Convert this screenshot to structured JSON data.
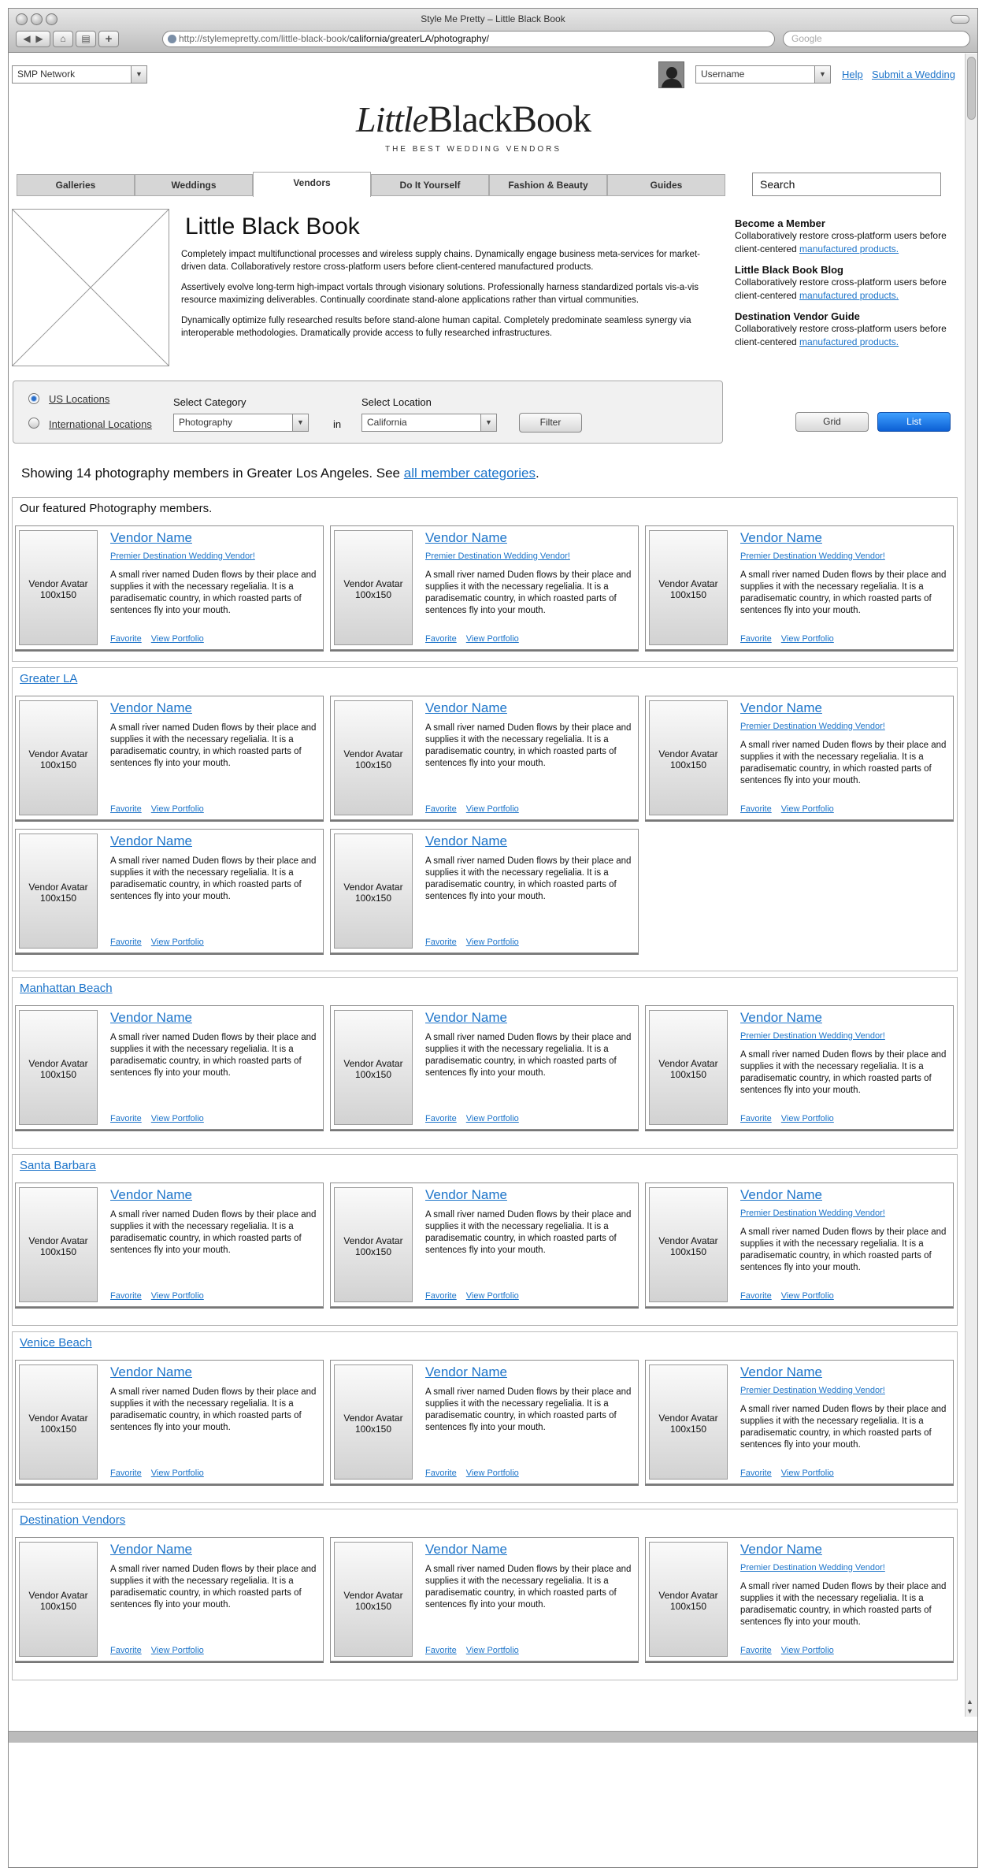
{
  "window": {
    "title": "Style Me Pretty – Little Black Book",
    "url_prefix": "http://stylemepretty.com/little-black-book/",
    "url_rest": "california/greaterLA/photography/",
    "search_placeholder": "Google"
  },
  "header": {
    "network": "SMP Network",
    "username": "Username",
    "help": "Help",
    "submit": "Submit a Wedding"
  },
  "logo": {
    "little": "Little",
    "black": "BlackBook",
    "tagline": "THE BEST WEDDING VENDORS"
  },
  "tabs": [
    "Galleries",
    "Weddings",
    "Vendors",
    "Do It Yourself",
    "Fashion & Beauty",
    "Guides"
  ],
  "active_tab": "Vendors",
  "search": "Search",
  "hero": {
    "title": "Little Black Book",
    "paragraphs": [
      "Completely impact multifunctional processes and wireless supply chains. Dynamically engage business meta-services for market-driven data. Collaboratively restore cross-platform users before client-centered manufactured products.",
      "Assertively evolve long-term high-impact vortals through visionary solutions. Professionally harness standardized portals vis-a-vis resource maximizing deliverables. Continually coordinate stand-alone applications rather than virtual communities.",
      "Dynamically optimize fully researched results before stand-alone human capital. Completely predominate seamless synergy via interoperable methodologies. Dramatically provide access to fully researched infrastructures."
    ]
  },
  "sidebar": [
    {
      "heading": "Become a Member",
      "text": "Collaboratively restore cross-platform users before client-centered ",
      "link": "manufactured products."
    },
    {
      "heading": "Little Black Book Blog",
      "text": "Collaboratively restore cross-platform users before client-centered ",
      "link": "manufactured products."
    },
    {
      "heading": "Destination Vendor Guide",
      "text": "Collaboratively restore cross-platform users before client-centered ",
      "link": "manufactured products."
    }
  ],
  "filter": {
    "us": "US Locations",
    "intl": "International Locations",
    "category_label": "Select Category",
    "category": "Photography",
    "in": "in",
    "location_label": "Select Location",
    "location": "California",
    "filter_btn": "Filter",
    "grid": "Grid",
    "list": "List"
  },
  "showing": {
    "text": "Showing 14 photography members in Greater Los Angeles. See ",
    "link": "all member categories",
    "end": "."
  },
  "card_text": {
    "avatar": "Vendor Avatar 100x150",
    "name": "Vendor Name",
    "premier": "Premier Destination Wedding Vendor!",
    "desc": "A small river named Duden flows by their place and supplies it with the necessary regelialia. It is a paradisematic country, in which roasted parts of sentences fly into your mouth.",
    "favorite": "Favorite",
    "portfolio": "View Portfolio"
  },
  "sections": [
    {
      "title": "Our featured Photography members.",
      "linked": false,
      "cards": [
        true,
        true,
        true
      ]
    },
    {
      "title": "Greater LA",
      "linked": true,
      "cards": [
        false,
        false,
        true,
        false,
        false
      ]
    },
    {
      "title": "Manhattan Beach",
      "linked": true,
      "cards": [
        false,
        false,
        true
      ]
    },
    {
      "title": "Santa Barbara",
      "linked": true,
      "cards": [
        false,
        false,
        true
      ]
    },
    {
      "title": "Venice Beach",
      "linked": true,
      "cards": [
        false,
        false,
        true
      ]
    },
    {
      "title": "Destination Vendors",
      "linked": true,
      "cards": [
        false,
        false,
        true
      ]
    }
  ]
}
